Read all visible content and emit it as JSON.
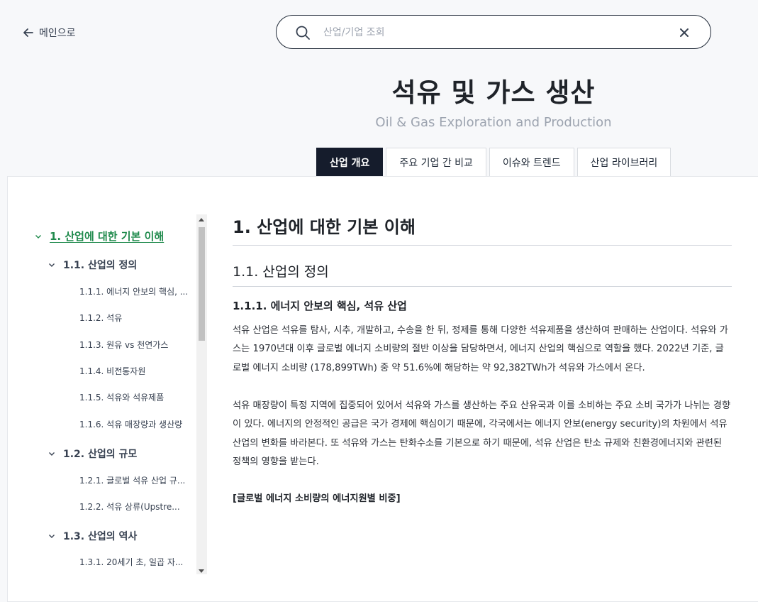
{
  "header": {
    "back_label": "메인으로",
    "search": {
      "placeholder": "산업/기업 조회",
      "value": ""
    }
  },
  "page": {
    "title": "석유 및 가스 생산",
    "subtitle": "Oil & Gas Exploration and Production"
  },
  "tabs": [
    {
      "label": "산업 개요",
      "active": true
    },
    {
      "label": "주요 기업 간 비교",
      "active": false
    },
    {
      "label": "이슈와 트렌드",
      "active": false
    },
    {
      "label": "산업 라이브러리",
      "active": false
    }
  ],
  "toc": {
    "items": [
      {
        "level": 1,
        "label": "1. 산업에 대한 기본 이해",
        "active": true
      },
      {
        "level": 2,
        "label": "1.1. 산업의 정의"
      },
      {
        "level": 3,
        "label": "1.1.1. 에너지 안보의 핵심, ..."
      },
      {
        "level": 3,
        "label": "1.1.2. 석유"
      },
      {
        "level": 3,
        "label": "1.1.3. 원유 vs 천연가스"
      },
      {
        "level": 3,
        "label": "1.1.4. 비전통자원"
      },
      {
        "level": 3,
        "label": "1.1.5. 석유와 석유제품"
      },
      {
        "level": 3,
        "label": "1.1.6. 석유 매장량과 생산량"
      },
      {
        "level": 2,
        "label": "1.2. 산업의 규모"
      },
      {
        "level": 3,
        "label": "1.2.1. 글로벌 석유 산업 규..."
      },
      {
        "level": 3,
        "label": "1.2.2. 석유 상류(Upstre..."
      },
      {
        "level": 2,
        "label": "1.3. 산업의 역사"
      },
      {
        "level": 3,
        "label": "1.3.1. 20세기 초, 일곱 자..."
      }
    ]
  },
  "content": {
    "h1": "1. 산업에 대한 기본 이해",
    "h2": "1.1. 산업의 정의",
    "h3": "1.1.1. 에너지 안보의 핵심, 석유 산업",
    "p1": "석유 산업은 석유를 탐사, 시추, 개발하고, 수송을 한 뒤, 정제를 통해 다양한 석유제품을 생산하여 판매하는 산업이다. 석유와 가스는 1970년대 이후 글로벌 에너지 소비량의 절반 이상을 담당하면서, 에너지 산업의 핵심으로 역할을 했다. 2022년 기준, 글로벌 에너지 소비량 (178,899TWh) 중 약 51.6%에 해당하는 약 92,382TWh가 석유와 가스에서 온다.",
    "p2": "석유 매장량이 특정 지역에 집중되어 있어서 석유와 가스를 생산하는 주요 산유국과 이를 소비하는 주요 소비 국가가 나뉘는 경향이 있다. 에너지의 안정적인 공급은 국가 경제에 핵심이기 때문에, 각국에서는 에너지 안보(energy security)의 차원에서 석유 산업의 변화를 바라본다. 또 석유와 가스는 탄화수소를 기본으로 하기 때문에, 석유 산업은 탄소 규제와 친환경에너지와 관련된 정책의 영향을 받는다.",
    "subhead": "[글로벌 에너지 소비량의 에너지원별 비중]"
  },
  "colors": {
    "accent": "#1f8a4c",
    "tab_active_bg": "#151c2c"
  }
}
